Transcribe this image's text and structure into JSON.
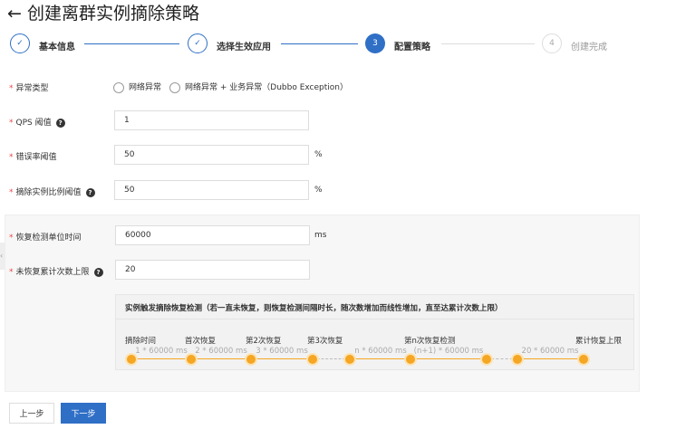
{
  "title": "← 创建离群实例摘除策略",
  "steps": [
    {
      "num": "✓",
      "label": "基本信息",
      "state": "done"
    },
    {
      "num": "✓",
      "label": "选择生效应用",
      "state": "done"
    },
    {
      "num": "3",
      "label": "配置策略",
      "state": "current"
    },
    {
      "num": "4",
      "label": "创建完成",
      "state": "todo"
    }
  ],
  "form": {
    "exception_type": {
      "label": "异常类型",
      "options": [
        "网络异常",
        "网络异常 + 业务异常（Dubbo Exception）"
      ]
    },
    "qps": {
      "label": "QPS 阈值",
      "value": "1"
    },
    "error_rate": {
      "label": "错误率阈值",
      "value": "50",
      "unit": "%"
    },
    "remove_ratio": {
      "label": "摘除实例比例阈值",
      "value": "50",
      "unit": "%"
    },
    "recovery_unit": {
      "label": "恢复检测单位时间",
      "value": "60000",
      "unit": "ms"
    },
    "max_unrecovered": {
      "label": "未恢复累计次数上限",
      "value": "20"
    }
  },
  "timeline": {
    "title": "实例触发摘除恢复检测（若一直未恢复，则恢复检测间隔时长，随次数增加而线性增加，直至达累计次数上限）",
    "labels": [
      "摘除时间",
      "首次恢复",
      "第2次恢复",
      "第3次恢复",
      "第n次恢复检测",
      "累计恢复上限"
    ],
    "intervals": [
      "1 * 60000 ms",
      "2 * 60000 ms",
      "3 * 60000 ms",
      "n * 60000 ms",
      "(n+1) * 60000 ms",
      "20 * 60000 ms"
    ]
  },
  "buttons": {
    "prev": "上一步",
    "next": "下一步"
  },
  "colors": {
    "primary": "#2f6fc6",
    "timeline": "#f5a623",
    "required": "#e44"
  }
}
